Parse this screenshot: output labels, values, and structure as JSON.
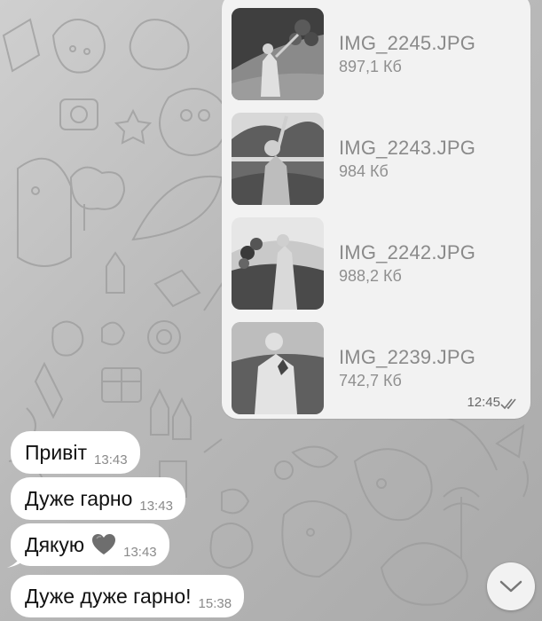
{
  "files_message": {
    "files": [
      {
        "name": "IMG_2245.JPG",
        "size": "897,1 Кб"
      },
      {
        "name": "IMG_2243.JPG",
        "size": "984 Кб"
      },
      {
        "name": "IMG_2242.JPG",
        "size": "988,2 Кб"
      },
      {
        "name": "IMG_2239.JPG",
        "size": "742,7 Кб"
      }
    ],
    "time": "12:45",
    "status_icon": "double-check-read-icon"
  },
  "messages": [
    {
      "text": "Привіт",
      "time": "13:43"
    },
    {
      "text": "Дуже гарно",
      "time": "13:43"
    },
    {
      "text": "Дякую",
      "emoji": "grey-heart-icon",
      "time": "13:43"
    },
    {
      "text": "Дуже дуже гарно!",
      "time": "15:38"
    }
  ],
  "scroll_button": {
    "icon": "chevron-down-icon"
  },
  "colors": {
    "bubble": "#ffffff",
    "file_bubble": "#f2f2f2",
    "background": "#bdbdbd",
    "meta_text": "#8a8a8a"
  }
}
